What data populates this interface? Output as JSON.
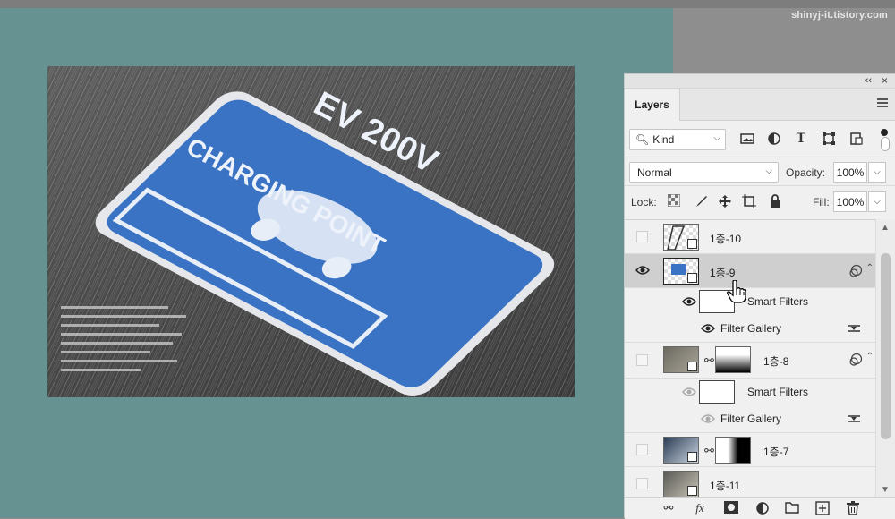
{
  "watermark": "shinyj-it.tistory.com",
  "photo": {
    "sign_text_top": "EV 200V",
    "sign_text_bottom": "CHARGING POINT"
  },
  "panel": {
    "collapse_symbol": "‹‹",
    "close_symbol": "×",
    "tab_label": "Layers",
    "filter": {
      "kind_label": "Kind",
      "icons": [
        "image-filter-icon",
        "adjustment-filter-icon",
        "type-filter-icon",
        "shape-filter-icon",
        "smart-object-filter-icon"
      ]
    },
    "blend_mode": "Normal",
    "opacity_label": "Opacity:",
    "opacity_value": "100%",
    "lock_label": "Lock:",
    "fill_label": "Fill:",
    "fill_value": "100%",
    "layers": [
      {
        "name": "1층-10",
        "visible": false,
        "selected": false
      },
      {
        "name": "1층-9",
        "visible": true,
        "selected": true,
        "smart_filters_label": "Smart Filters",
        "filter_name": "Filter Gallery"
      },
      {
        "name": "1층-8",
        "visible": false,
        "selected": false,
        "smart_filters_label": "Smart Filters",
        "filter_name": "Filter Gallery"
      },
      {
        "name": "1층-7",
        "visible": false,
        "selected": false
      },
      {
        "name": "1층-11",
        "visible": false,
        "selected": false
      }
    ],
    "footer_icons": [
      "link-layers-icon",
      "fx-icon",
      "add-mask-icon",
      "adjustment-layer-icon",
      "new-group-icon",
      "new-layer-icon",
      "delete-layer-icon"
    ],
    "footer_fx_label": "fx"
  },
  "colors": {
    "canvas_bg": "#669391",
    "sign_blue": "#3a73c4",
    "selected_row": "#cfcfcf"
  }
}
